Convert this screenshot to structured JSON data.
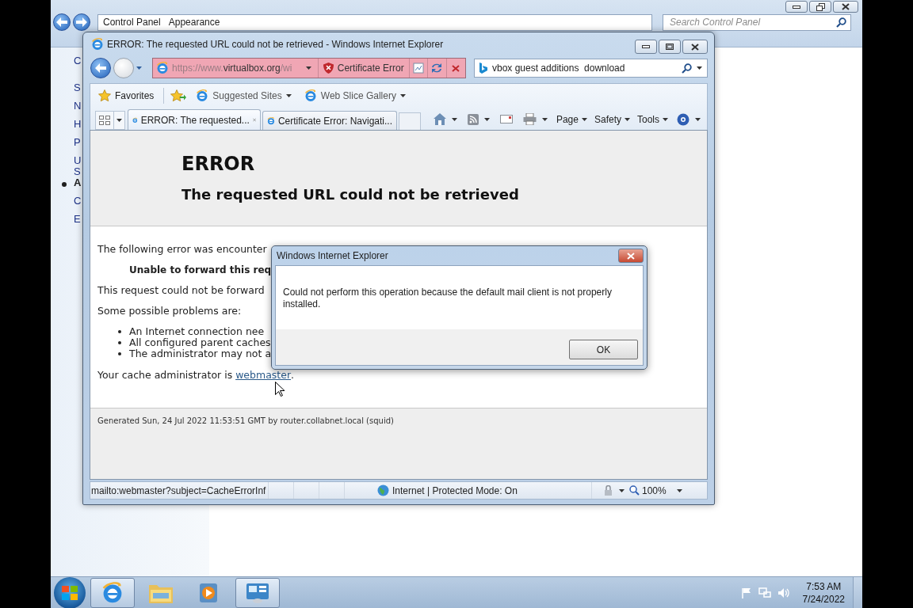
{
  "control_panel": {
    "breadcrumb": [
      "Control Panel",
      "Appearance"
    ],
    "search": {
      "placeholder": "Search Control Panel"
    },
    "sidebar": [
      {
        "label": "C",
        "selected": false
      },
      {
        "label": "S",
        "selected": false
      },
      {
        "label": "N",
        "selected": false
      },
      {
        "label": "H",
        "selected": false
      },
      {
        "label": "P",
        "selected": false
      },
      {
        "label": "U S",
        "selected": false
      },
      {
        "label": "A",
        "selected": true
      },
      {
        "label": "C",
        "selected": false
      },
      {
        "label": "E",
        "selected": false
      }
    ]
  },
  "browser": {
    "title": "ERROR: The requested URL could not be retrieved - Windows Internet Explorer",
    "address": {
      "prefix": "https://www.",
      "domain": "virtualbox.org",
      "rest": "/wi"
    },
    "certificate_error": "Certificate Error",
    "search": {
      "value": "vbox guest additions  download"
    },
    "favorites_button": "Favorites",
    "favorites_links": [
      "Suggested Sites",
      "Web Slice Gallery"
    ],
    "tabs": [
      {
        "label": "ERROR: The requested...",
        "selected": true
      },
      {
        "label": "Certificate Error: Navigati...",
        "selected": false
      }
    ],
    "command_bar": [
      "Page",
      "Safety",
      "Tools"
    ],
    "page": {
      "heading": "ERROR",
      "subheading": "The requested URL could not be retrieved",
      "intro": "The following error was encounter",
      "error_line": "Unable to forward this req",
      "detail": "This request could not be forward",
      "problems_heading": "Some possible problems are:",
      "problems": [
        "An Internet connection nee",
        "All configured parent caches",
        "The administrator may not a"
      ],
      "admin_text": "Your cache administrator is ",
      "admin_link": "webmaster",
      "admin_end": ".",
      "footer": "Generated Sun, 24 Jul 2022 11:53:51 GMT by router.collabnet.local (squid)"
    },
    "status_bar": {
      "url": "mailto:webmaster?subject=CacheErrorInf",
      "zone": "Internet | Protected Mode: On",
      "zoom": "100%"
    }
  },
  "dialog": {
    "title": "Windows Internet Explorer",
    "message": "Could not perform this operation because the default mail client is not properly installed.",
    "buttons": [
      "OK"
    ]
  },
  "taskbar": {
    "apps": [
      {
        "kind": "browser",
        "selected": true
      },
      {
        "kind": "folder",
        "selected": false
      },
      {
        "kind": "media",
        "selected": false
      },
      {
        "kind": "control-panel",
        "selected": true
      }
    ],
    "time": "7:53 AM",
    "date": "7/24/2022"
  }
}
